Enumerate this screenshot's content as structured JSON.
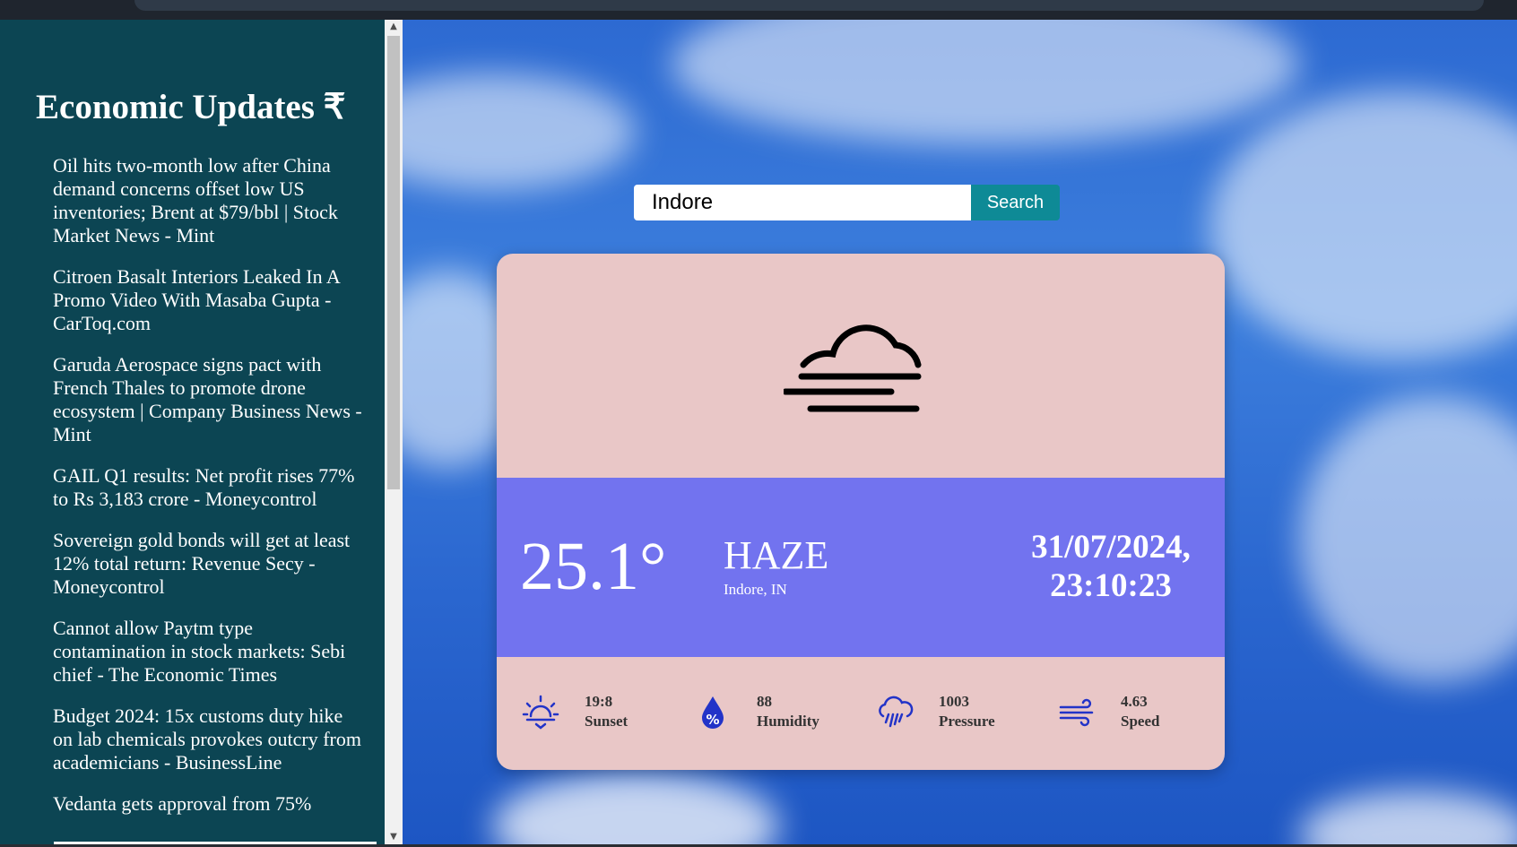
{
  "sidebar": {
    "title": "Economic Updates ₹",
    "news": [
      "Oil hits two-month low after China demand concerns offset low US inventories; Brent at $79/bbl | Stock Market News - Mint",
      "Citroen Basalt Interiors Leaked In A Promo Video With Masaba Gupta - CarToq.com",
      "Garuda Aerospace signs pact with French Thales to promote drone ecosystem | Company Business News - Mint",
      "GAIL Q1 results: Net profit rises 77% to Rs 3,183 crore - Moneycontrol",
      "Sovereign gold bonds will get at least 12% total return: Revenue Secy - Moneycontrol",
      "Cannot allow Paytm type contamination in stock markets: Sebi chief - The Economic Times",
      "Budget 2024: 15x customs duty hike on lab chemicals provokes outcry from academicians - BusinessLine",
      "Vedanta gets approval from 75%"
    ]
  },
  "search": {
    "value": "Indore",
    "button_label": "Search"
  },
  "weather": {
    "icon": "haze-icon",
    "temperature": "25.1°",
    "condition": "HAZE",
    "location": "Indore, IN",
    "date": "31/07/2024,",
    "time": "23:10:23",
    "stats": [
      {
        "icon": "sunset-icon",
        "value": "19:8",
        "label": "Sunset"
      },
      {
        "icon": "humidity-icon",
        "value": "88",
        "label": "Humidity"
      },
      {
        "icon": "pressure-icon",
        "value": "1003",
        "label": "Pressure"
      },
      {
        "icon": "wind-icon",
        "value": "4.63",
        "label": "Speed"
      }
    ]
  },
  "colors": {
    "sidebar_bg": "#0c4553",
    "card_pink": "#e9c7c7",
    "card_purple": "#7273ef",
    "search_button": "#0e8a96",
    "stat_icon": "#2233c8"
  }
}
